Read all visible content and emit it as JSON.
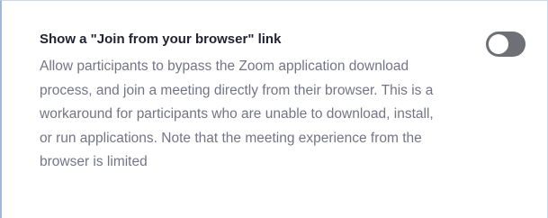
{
  "setting": {
    "title": "Show a \"Join from your browser\" link",
    "description": "Allow participants to bypass the Zoom application download process, and join a meeting directly from their browser. This is a workaround for participants who are unable to download, install, or run applications. Note that the meeting experience from the browser is limited",
    "toggle_state": "off"
  },
  "colors": {
    "toggle_track": "#6e7076",
    "title_text": "#232333",
    "description_text": "#747487",
    "panel_border": "#9fb8d9"
  }
}
